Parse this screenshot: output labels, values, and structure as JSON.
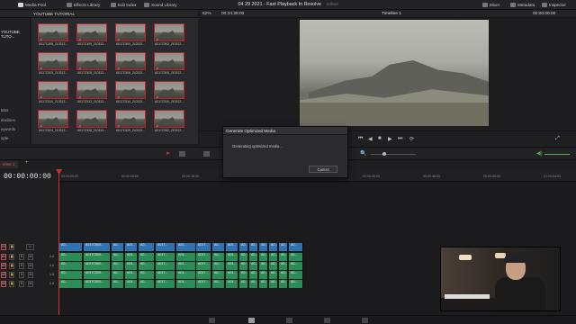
{
  "topbar": {
    "media_pool": "Media Pool",
    "effects_library": "Effects Library",
    "edit_index": "Edit Index",
    "sound_library": "Sound Library",
    "project_title": "04 29 2021 - Fast Playback In Resolve",
    "edited": "Edited",
    "mixer": "Mixer",
    "metadata": "Metadata",
    "inspector": "Inspector"
  },
  "media_pool": {
    "bin_title": "YOUTUBE TUTORIAL",
    "side_items": [
      "YOUTUBE TUTO...",
      "Bins",
      "imelines",
      "eywords",
      "ople"
    ],
    "clips": [
      "A017C498_210312...",
      "A017C499_210312...",
      "A017C500_210312...",
      "A017C502_210312...",
      "A017C503_210312...",
      "A017C505_210312...",
      "A017C506_210312...",
      "A017C508_210312...",
      "A017C510_210312...",
      "A017C512_210312...",
      "A017C514_210312...",
      "A017C516_210312...",
      "A017C524_210312...",
      "A017C528_210312...",
      "A017C529_210312...",
      "A017C532_210312..."
    ]
  },
  "viewer": {
    "zoom": "62%",
    "source_timecode": "00:34:38:00",
    "timeline_name": "Timeline 1",
    "record_timecode": "00:00:00:00"
  },
  "dialog": {
    "title": "Generate Optimized Media",
    "message": "Generating optimized media...",
    "cancel": "Cancel"
  },
  "timeline": {
    "tab_name": "eline 1",
    "timecode": "00:00:00:00",
    "ruler_ticks": [
      "00:00:00:00",
      "00:00:08:00",
      "00:00:16:00",
      "00:00:24:00",
      "00:00:32:00",
      "00:00:40:00",
      "00:00:48:00",
      "00:00:56:00",
      "01:00:04:00"
    ],
    "track_labels": [
      "V1",
      "A1",
      "A2",
      "A3",
      "A4"
    ],
    "track_level": "1.0",
    "clip_labels": {
      "c1": "A0...",
      "c2": "A017C500...",
      "c3": "A017C50...",
      "c4": "A01...",
      "c5": "A017...",
      "c6": "A0..."
    }
  },
  "colors": {
    "video_clip": "#2f74b0",
    "audio_clip": "#2b8c57",
    "playhead": "#d22d2d",
    "thumb_border": "#c21f23"
  }
}
